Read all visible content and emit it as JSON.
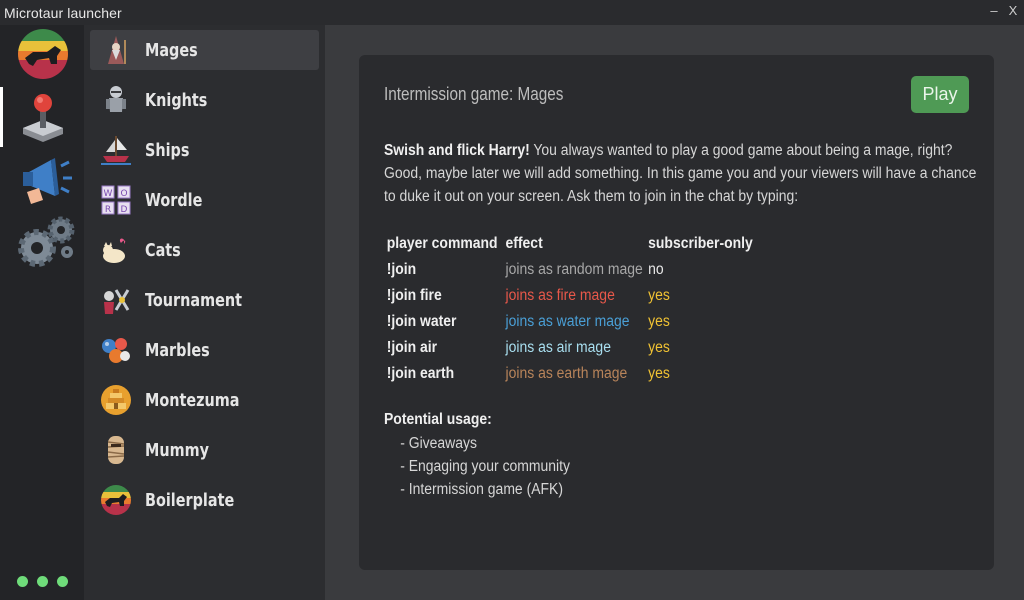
{
  "window": {
    "title": "Microtaur launcher",
    "minimize": "–",
    "close": "X"
  },
  "rail": {
    "items": [
      {
        "name": "microtaur-logo-icon"
      },
      {
        "name": "joystick-icon"
      },
      {
        "name": "megaphone-icon"
      },
      {
        "name": "gears-icon"
      }
    ],
    "status_color": "#6fdc7a"
  },
  "games": [
    {
      "label": "Mages",
      "icon": "mage-icon"
    },
    {
      "label": "Knights",
      "icon": "knight-icon"
    },
    {
      "label": "Ships",
      "icon": "ship-icon"
    },
    {
      "label": "Wordle",
      "icon": "wordle-icon"
    },
    {
      "label": "Cats",
      "icon": "cat-icon"
    },
    {
      "label": "Tournament",
      "icon": "tournament-icon"
    },
    {
      "label": "Marbles",
      "icon": "marbles-icon"
    },
    {
      "label": "Montezuma",
      "icon": "montezuma-icon"
    },
    {
      "label": "Mummy",
      "icon": "mummy-icon"
    },
    {
      "label": "Boilerplate",
      "icon": "boilerplate-icon"
    }
  ],
  "detail": {
    "heading": "Intermission game:  Mages",
    "play_label": "Play",
    "intro_bold": "Swish and flick Harry!",
    "intro_rest": " You always wanted to play a good game about being a mage, right? Good, maybe later we will add something. In this game you and your viewers will have a chance to duke it out on your screen. Ask them to join in the chat by typing:",
    "table": {
      "headers": [
        "player command",
        "effect",
        "subscriber-only"
      ],
      "rows": [
        {
          "cmd": "!join",
          "effect": "joins as random mage",
          "color": "#a8a8a8",
          "sub": "no"
        },
        {
          "cmd": "!join fire",
          "effect": "joins as fire mage",
          "color": "#e8584a",
          "sub": "yes"
        },
        {
          "cmd": "!join water",
          "effect": "joins as water mage",
          "color": "#4a9fd6",
          "sub": "yes"
        },
        {
          "cmd": "!join air",
          "effect": "joins as air mage",
          "color": "#a9dff0",
          "sub": "yes"
        },
        {
          "cmd": "!join earth",
          "effect": "joins as earth mage",
          "color": "#b8845a",
          "sub": "yes"
        }
      ]
    },
    "usage_title": "Potential usage:",
    "usage_items": [
      "- Giveaways",
      "- Engaging your community",
      "- Intermission game (AFK)"
    ]
  }
}
